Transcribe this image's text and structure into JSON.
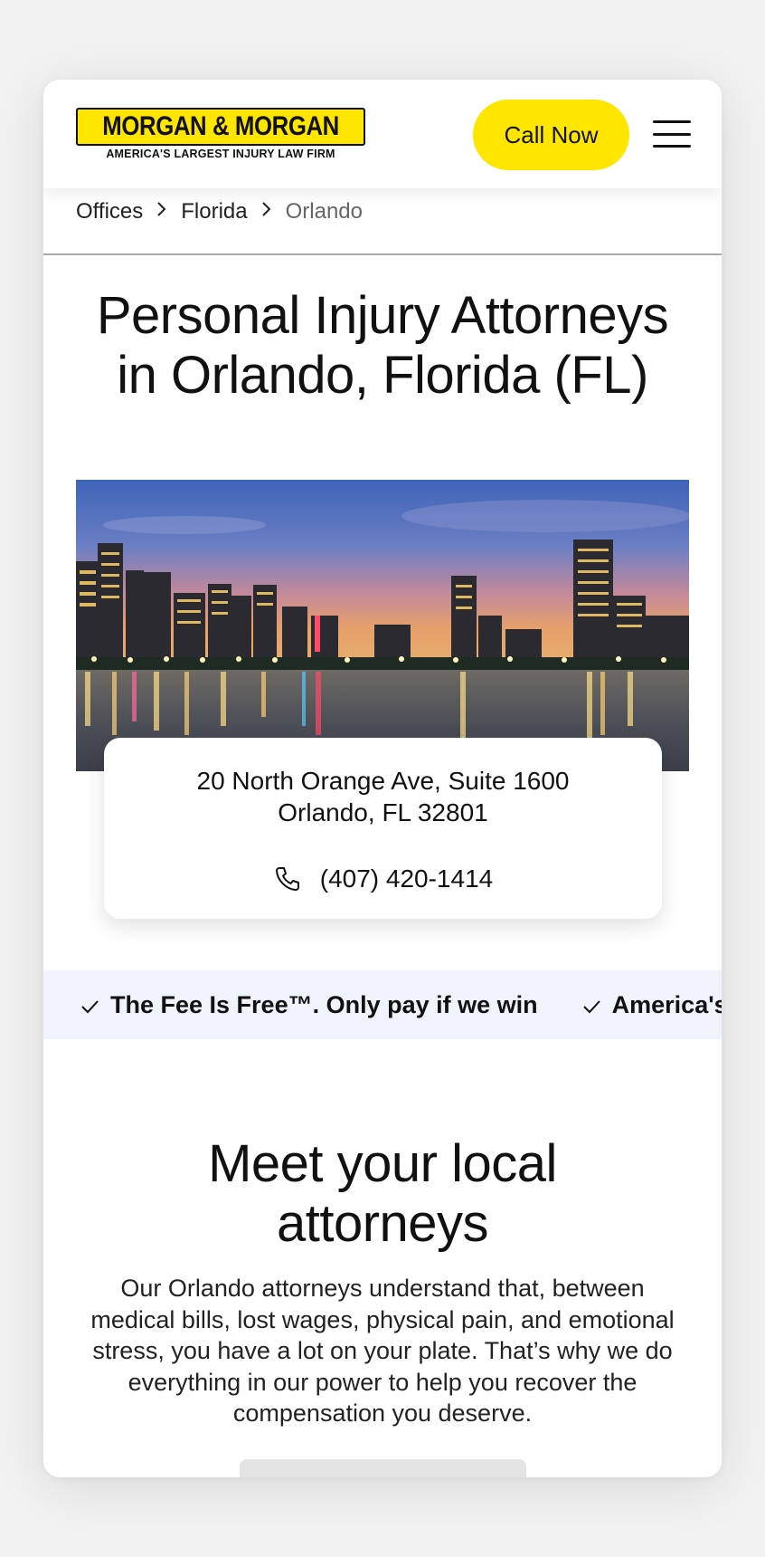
{
  "header": {
    "logo_main": "MORGAN & MORGAN",
    "logo_tagline": "AMERICA'S LARGEST INJURY LAW FIRM",
    "call_label": "Call Now",
    "menu_icon": "hamburger-menu-icon"
  },
  "breadcrumb": {
    "items": [
      "Offices",
      "Florida",
      "Orlando"
    ],
    "separator_icon": "chevron-right-icon"
  },
  "page_title": "Personal Injury Attorneys in Orlando, Florida (FL)",
  "hero_image": {
    "description": "Orlando city skyline at dusk reflected in Lake Eola"
  },
  "office_card": {
    "address_line1": "20 North Orange Ave, Suite 1600",
    "address_line2": "Orlando, FL 32801",
    "phone": "(407) 420-1414",
    "phone_icon": "phone-icon"
  },
  "benefits_banner": {
    "items": [
      "The Fee Is Free™. Only pay if we win",
      "America's Largest Injury Law Firm"
    ],
    "check_icon": "check-icon"
  },
  "meet_section": {
    "title": "Meet your local attorneys",
    "body": "Our Orlando attorneys understand that, between medical bills, lost wages, physical pain, and emotional stress, you have a lot on your plate. That’s why we do everything in our power to help you recover the compensation you deserve."
  },
  "colors": {
    "brand_yellow": "#ffe600",
    "banner_bg": "#eef3fc",
    "page_bg": "#f2f2f2",
    "text": "#111111"
  }
}
